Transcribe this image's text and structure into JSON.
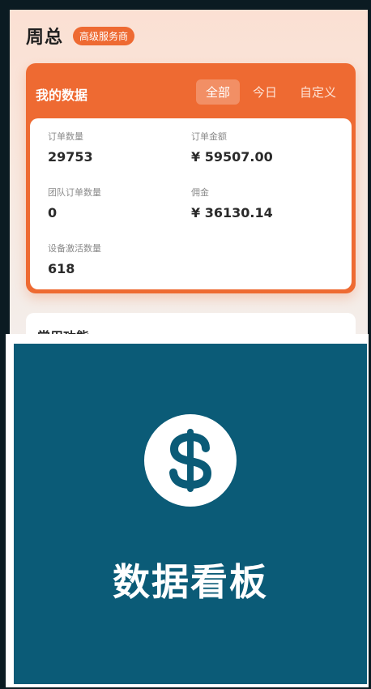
{
  "header": {
    "name": "周总",
    "badge": "高级服务商"
  },
  "data_card": {
    "title": "我的数据",
    "tabs": [
      "全部",
      "今日",
      "自定义"
    ],
    "active_tab": "全部",
    "metrics": {
      "order_count": {
        "label": "订单数量",
        "value": "29753"
      },
      "order_amount": {
        "label": "订单金额",
        "value": "¥ 59507.00"
      },
      "team_order_count": {
        "label": "团队订单数量",
        "value": "0"
      },
      "commission": {
        "label": "佣金",
        "value": "¥ 36130.14"
      },
      "device_activation": {
        "label": "设备激活数量",
        "value": "618"
      }
    }
  },
  "common": {
    "title": "常用功能"
  },
  "tile": {
    "title": "数据看板",
    "icon": "dollar-coin-icon"
  },
  "colors": {
    "accent": "#ee6a32",
    "tile_bg": "#0b5b77"
  }
}
